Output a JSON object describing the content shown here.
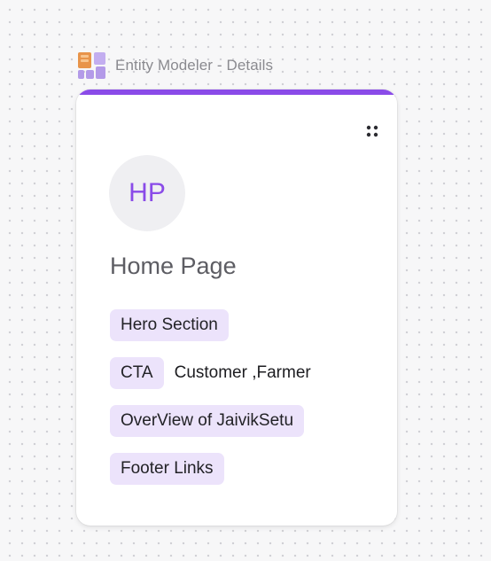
{
  "frame": {
    "title": "Entity Modeler - Details"
  },
  "card": {
    "avatar_initials": "HP",
    "title": "Home Page",
    "fields": [
      {
        "label": "Hero Section",
        "value": ""
      },
      {
        "label": "CTA",
        "value": "Customer ,Farmer"
      },
      {
        "label": "OverView of JaivikSetu",
        "value": ""
      },
      {
        "label": "Footer Links",
        "value": ""
      }
    ]
  },
  "icons": {
    "frame_icon": "entity-modeler-app-icon",
    "drag_handle": "drag-handle-icon"
  },
  "colors": {
    "accent": "#8a4be8",
    "avatar_text": "#8a4be8",
    "tag_background": "#ece3fb",
    "app_icon_orange": "#e8944a",
    "app_icon_purple": "#b39ae8"
  }
}
